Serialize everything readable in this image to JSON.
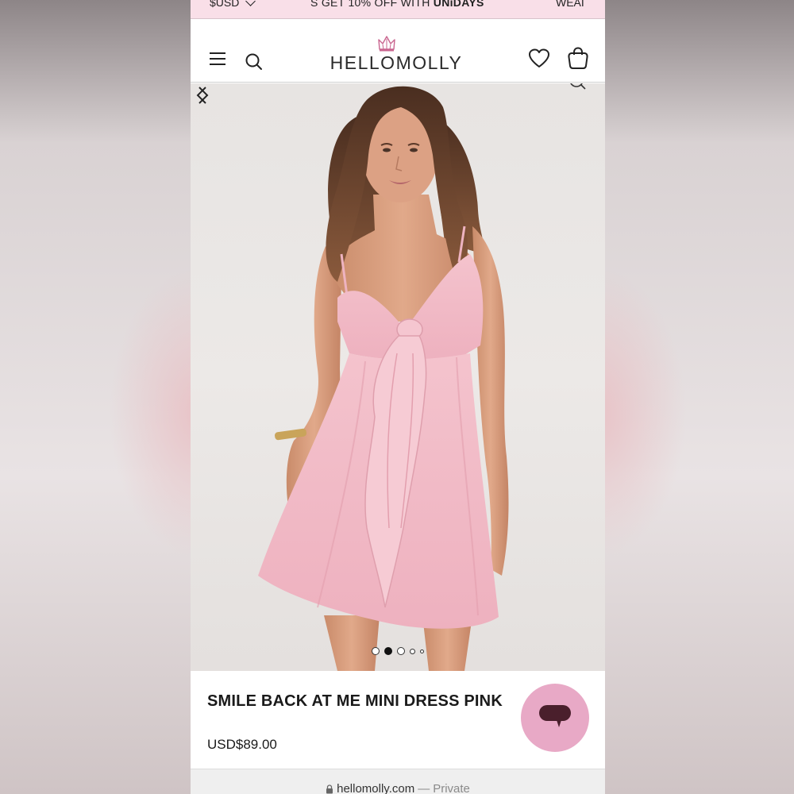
{
  "promo": {
    "currency": "$USD",
    "message_prefix": "S GET 10% OFF WITH ",
    "message_brand": "UNiDAYS",
    "right_text": "WEAI"
  },
  "header": {
    "logo_text": "HELLOMOLLY",
    "icons": [
      "menu-icon",
      "search-icon",
      "crown-icon",
      "heart-icon",
      "bag-icon"
    ]
  },
  "gallery": {
    "total_images": 5,
    "active_index": 1,
    "icons": [
      "chevron-left-icon",
      "chevron-right-icon"
    ]
  },
  "product": {
    "title": "SMILE BACK AT ME MINI DRESS PINK",
    "price": "USD$89.00"
  },
  "chat": {
    "icon": "chat-bubble-icon",
    "color": "#e8a9c6"
  },
  "browser": {
    "url": "hellomolly.com",
    "separator": "—",
    "mode": "Private"
  },
  "colors": {
    "promo_bg": "#f9dfe8",
    "dress_pink": "#f0b8c4",
    "chat_pink": "#e8a9c6"
  }
}
